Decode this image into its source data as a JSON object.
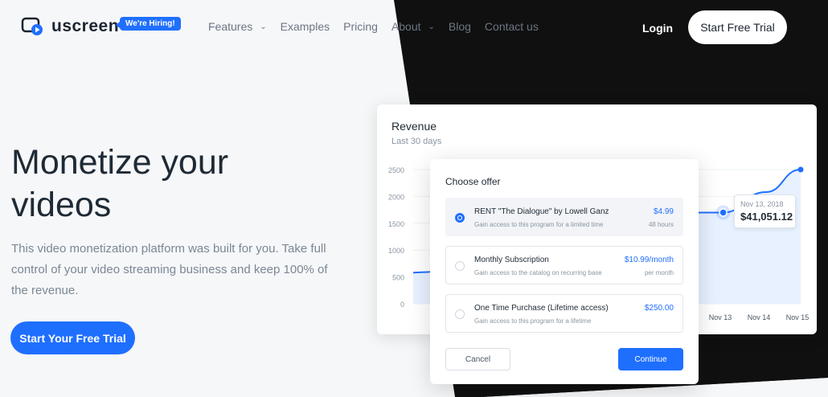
{
  "colors": {
    "accent": "#1f6fff",
    "dark": "#101010",
    "text": "#1e2a35",
    "muted": "#7b8794"
  },
  "nav": {
    "brand": "uscreen",
    "hiring_badge": "We're Hiring!",
    "menu": [
      {
        "label": "Features",
        "has_dropdown": true
      },
      {
        "label": "Examples",
        "has_dropdown": false
      },
      {
        "label": "Pricing",
        "has_dropdown": false
      },
      {
        "label": "About",
        "has_dropdown": true
      },
      {
        "label": "Blog",
        "has_dropdown": false
      },
      {
        "label": "Contact us",
        "has_dropdown": false
      }
    ],
    "login": "Login",
    "cta": "Start Free Trial"
  },
  "hero": {
    "title_line1": "Monetize your",
    "title_line2": "videos",
    "subtitle": "This video monetization platform was built for you. Take full control of your video streaming business and keep 100% of the revenue.",
    "cta": "Start Your Free Trial"
  },
  "revenue": {
    "title": "Revenue",
    "subtitle": "Last 30 days",
    "tooltip": {
      "date": "Nov 13, 2018",
      "value": "$41,051.12"
    }
  },
  "chart_data": {
    "type": "area",
    "title": "Revenue",
    "subtitle": "Last 30 days",
    "y_ticks": [
      "2500",
      "2000",
      "1500",
      "1000",
      "500",
      "0"
    ],
    "ylim": [
      0,
      2500
    ],
    "x_ticks": [
      "Nov 13",
      "Nov 14",
      "Nov 15"
    ],
    "series": [
      {
        "points": [
          [
            0,
            580
          ],
          [
            0.03,
            590
          ],
          [
            0.06,
            600
          ],
          [
            0.745,
            1700
          ],
          [
            0.8,
            1700
          ],
          [
            0.91,
            2080
          ],
          [
            1.0,
            2500
          ]
        ]
      }
    ],
    "highlight_index": 4,
    "grid": true
  },
  "offer": {
    "title": "Choose offer",
    "options": [
      {
        "name": "RENT \"The Dialogue\" by Lowell Ganz",
        "desc": "Gain access to this program for a limited time",
        "price": "$4.99",
        "term": "48 hours",
        "selected": true
      },
      {
        "name": "Monthly Subscription",
        "desc": "Gain access to the catalog on recurring base",
        "price": "$10.99/month",
        "term": "per month",
        "selected": false
      },
      {
        "name": "One Time Purchase (Lifetime access)",
        "desc": "Gain access to this program for a lifetime",
        "price": "$250.00",
        "term": "",
        "selected": false
      }
    ],
    "cancel": "Cancel",
    "continue": "Continue"
  }
}
